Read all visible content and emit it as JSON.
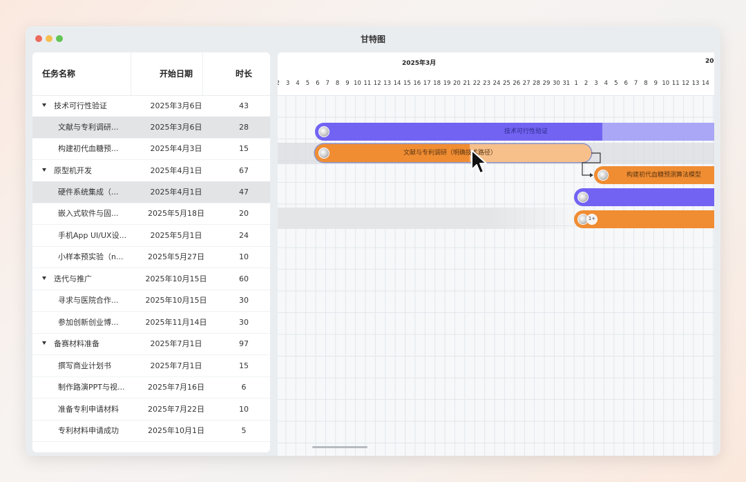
{
  "window": {
    "title": "甘特图"
  },
  "table": {
    "headers": {
      "name": "任务名称",
      "start": "开始日期",
      "duration": "时长"
    },
    "rows": [
      {
        "name": "技术可行性验证",
        "start": "2025年3月6日",
        "duration": "43",
        "group": true
      },
      {
        "name": "文献与专利调研...",
        "start": "2025年3月6日",
        "duration": "28",
        "group": false,
        "selected": true
      },
      {
        "name": "构建初代血糖预...",
        "start": "2025年4月3日",
        "duration": "15",
        "group": false
      },
      {
        "name": "原型机开发",
        "start": "2025年4月1日",
        "duration": "67",
        "group": true
      },
      {
        "name": "硬件系统集成（...",
        "start": "2025年4月1日",
        "duration": "47",
        "group": false
      },
      {
        "name": "嵌入式软件与固...",
        "start": "2025年5月18日",
        "duration": "20",
        "group": false
      },
      {
        "name": "手机App UI/UX设...",
        "start": "2025年5月1日",
        "duration": "24",
        "group": false
      },
      {
        "name": "小样本预实验（n...",
        "start": "2025年5月27日",
        "duration": "10",
        "group": false
      },
      {
        "name": "迭代与推广",
        "start": "2025年10月15日",
        "duration": "60",
        "group": true
      },
      {
        "name": "寻求与医院合作...",
        "start": "2025年10月15日",
        "duration": "30",
        "group": false
      },
      {
        "name": "参加创新创业博...",
        "start": "2025年11月14日",
        "duration": "30",
        "group": false
      },
      {
        "name": "备赛材料准备",
        "start": "2025年7月1日",
        "duration": "97",
        "group": true
      },
      {
        "name": "撰写商业计划书",
        "start": "2025年7月1日",
        "duration": "15",
        "group": false
      },
      {
        "name": "制作路演PPT与视...",
        "start": "2025年7月16日",
        "duration": "6",
        "group": false
      },
      {
        "name": "准备专利申请材料",
        "start": "2025年7月22日",
        "duration": "10",
        "group": false
      },
      {
        "name": "专利材料申请成功",
        "start": "2025年10月1日",
        "duration": "5",
        "group": false
      }
    ]
  },
  "timeline": {
    "months": [
      "2025年3月",
      "202"
    ],
    "days": [
      "2",
      "3",
      "4",
      "5",
      "6",
      "7",
      "8",
      "9",
      "10",
      "11",
      "12",
      "13",
      "14",
      "15",
      "16",
      "17",
      "18",
      "19",
      "20",
      "21",
      "22",
      "23",
      "24",
      "25",
      "26",
      "27",
      "28",
      "29",
      "30",
      "31",
      "1",
      "2",
      "3",
      "4",
      "5",
      "6",
      "7",
      "8",
      "9",
      "10",
      "11",
      "12",
      "13",
      "14",
      "1"
    ]
  },
  "bars": {
    "feasibility": {
      "label": "技术可行性验证",
      "progress": 0.72,
      "color": "#7363f3",
      "remaining_color": "#a9a7f6"
    },
    "literature": {
      "label": "文献与专利调研（明确技术路径）",
      "progress": 0.56,
      "color": "#f08d33",
      "remaining_color": "#f7c08b"
    },
    "model": {
      "label": "构建初代血糖预测算法模型",
      "color": "#f08d33"
    },
    "prototype": {
      "color": "#7363f3"
    },
    "hardware": {
      "color": "#f08d33",
      "avatar_count": "1+"
    }
  }
}
